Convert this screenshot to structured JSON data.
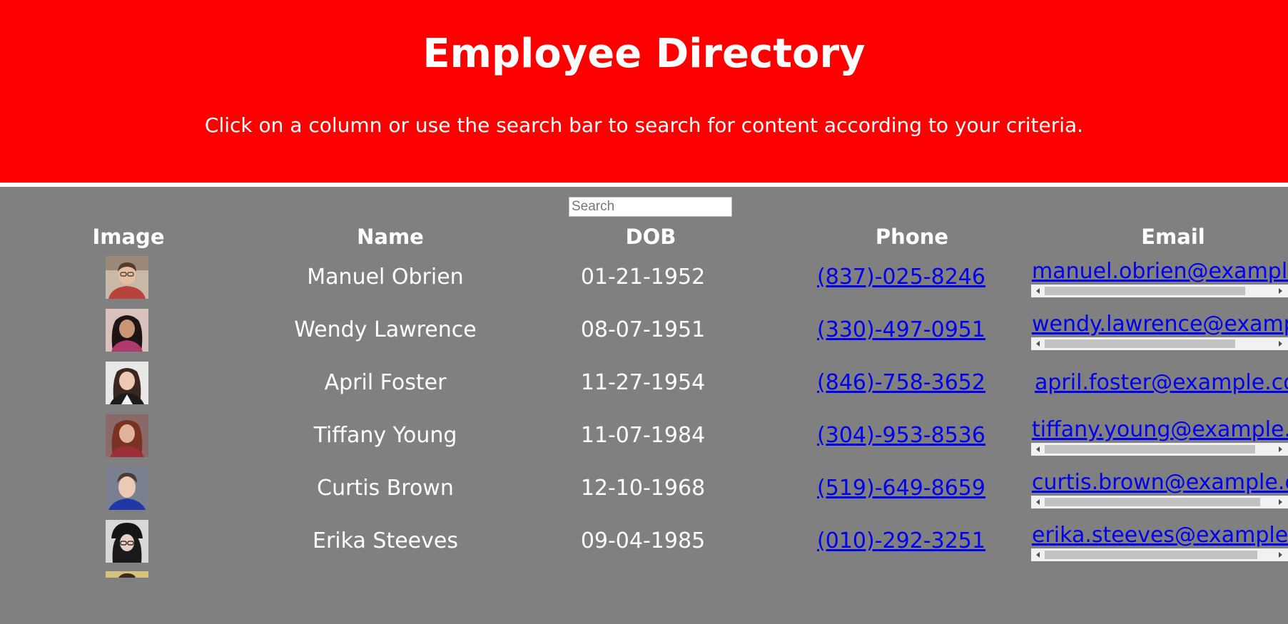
{
  "header": {
    "title": "Employee Directory",
    "subtitle": "Click on a column or use the search bar to search for content according to your criteria."
  },
  "search": {
    "placeholder": "Search",
    "value": ""
  },
  "columns": [
    "Image",
    "Name",
    "DOB",
    "Phone",
    "Email"
  ],
  "employees": [
    {
      "name": "Manuel Obrien",
      "dob": "01-21-1952",
      "phone": "(837)-025-8246",
      "email": "manuel.obrien@example.com",
      "avatar": "avatar-man-red-shirt"
    },
    {
      "name": "Wendy Lawrence",
      "dob": "08-07-1951",
      "phone": "(330)-497-0951",
      "email": "wendy.lawrence@example.com",
      "avatar": "avatar-woman-dark-hair"
    },
    {
      "name": "April Foster",
      "dob": "11-27-1954",
      "phone": "(846)-758-3652",
      "email": "april.foster@example.com",
      "avatar": "avatar-woman-light-background"
    },
    {
      "name": "Tiffany Young",
      "dob": "11-07-1984",
      "phone": "(304)-953-8536",
      "email": "tiffany.young@example.com",
      "avatar": "avatar-woman-auburn-hair"
    },
    {
      "name": "Curtis Brown",
      "dob": "12-10-1968",
      "phone": "(519)-649-8659",
      "email": "curtis.brown@example.com",
      "avatar": "avatar-man-blue-shirt"
    },
    {
      "name": "Erika Steeves",
      "dob": "09-04-1985",
      "phone": "(010)-292-3251",
      "email": "erika.steeves@example.com",
      "avatar": "avatar-woman-black-hat"
    }
  ],
  "colors": {
    "header_bg": "#ff0000",
    "page_bg": "#808080",
    "text": "#ffffff",
    "link": "#0000ee"
  }
}
